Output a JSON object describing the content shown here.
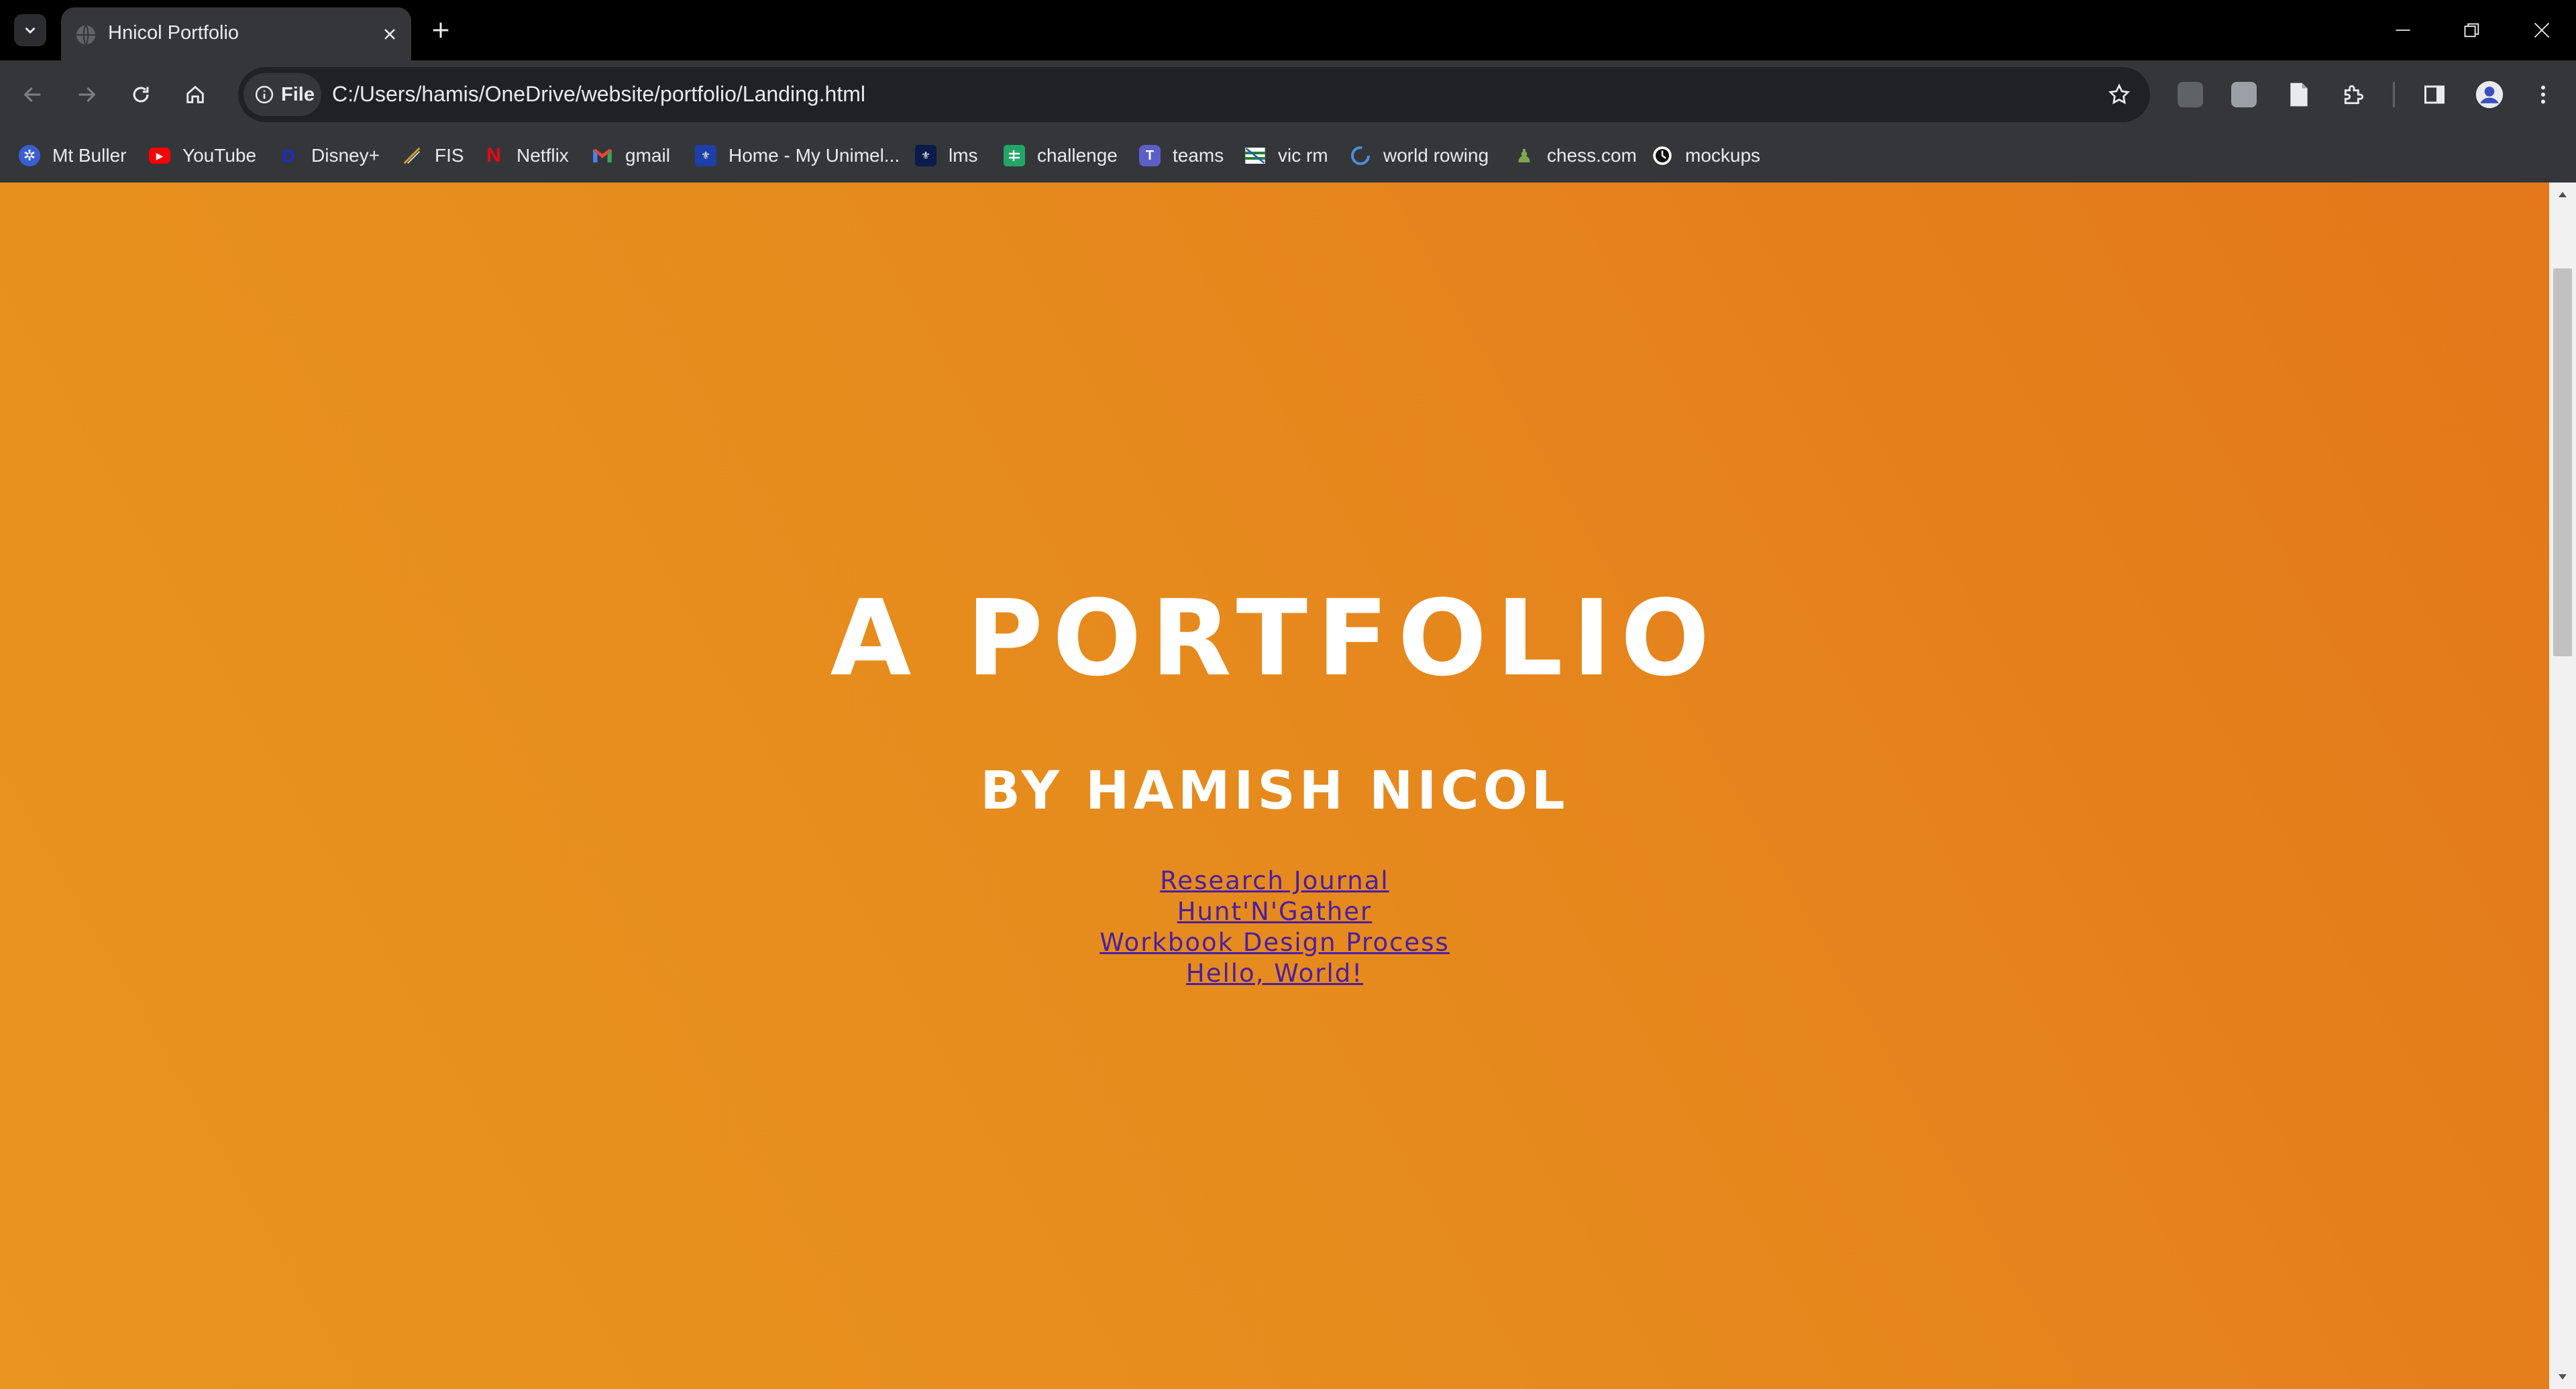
{
  "browser": {
    "tab": {
      "title": "Hnicol Portfolio"
    },
    "omnibox": {
      "chip_label": "File",
      "url": "C:/Users/hamis/OneDrive/website/portfolio/Landing.html"
    },
    "bookmarks": [
      {
        "label": "Mt Buller",
        "icon": "mt-buller-icon",
        "color": "#3b5fd0"
      },
      {
        "label": "YouTube",
        "icon": "youtube-icon",
        "color": "#ff0000"
      },
      {
        "label": "Disney+",
        "icon": "disney-plus-icon",
        "color": "#1b2bd8"
      },
      {
        "label": "FIS",
        "icon": "fis-icon",
        "color": "#d4a020"
      },
      {
        "label": "Netflix",
        "icon": "netflix-icon",
        "color": "#e50914"
      },
      {
        "label": "gmail",
        "icon": "gmail-icon",
        "color": "#ea4335"
      },
      {
        "label": "Home - My Unimel...",
        "icon": "unimelb-icon",
        "color": "#1d3fa8"
      },
      {
        "label": "lms",
        "icon": "lms-icon",
        "color": "#0b1b4a"
      },
      {
        "label": "challenge",
        "icon": "google-sheets-icon",
        "color": "#23a566"
      },
      {
        "label": "teams",
        "icon": "teams-icon",
        "color": "#5b5fc7"
      },
      {
        "label": "vic rm",
        "icon": "vic-rm-icon",
        "color": "#2e7d32"
      },
      {
        "label": "world rowing",
        "icon": "world-rowing-icon",
        "color": "#4a90d9"
      },
      {
        "label": "chess.com",
        "icon": "chess-icon",
        "color": "#7fa650"
      },
      {
        "label": "mockups",
        "icon": "mockups-icon",
        "color": "#111111"
      }
    ]
  },
  "page": {
    "title": "A PORTFOLIO",
    "subtitle": "BY HAMISH NICOL",
    "links": [
      "Research Journal",
      "Hunt'N'Gather",
      "Workbook Design Process",
      "Hello, World!"
    ]
  },
  "colors": {
    "gradient_start": "#e9951f",
    "gradient_end": "#e3771a",
    "heading": "#ffffff",
    "link": "#4b1fa0"
  }
}
